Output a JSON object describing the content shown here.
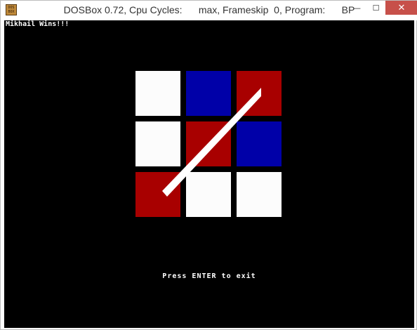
{
  "window": {
    "app_icon_label": "DOS BOX",
    "title": "DOSBox 0.72, Cpu Cycles:      max, Frameskip  0, Program:      BP",
    "controls": {
      "minimize": "—",
      "maximize": "☐",
      "close": "✕"
    }
  },
  "game": {
    "status_text": "Mikhail Wins!!!",
    "footer_text": "Press ENTER to exit",
    "board": [
      [
        "white",
        "blue",
        "red"
      ],
      [
        "white",
        "red",
        "blue"
      ],
      [
        "red",
        "white",
        "white"
      ]
    ],
    "winning_line": "anti-diagonal",
    "colors": {
      "white": "#fcfcfc",
      "blue": "#0000a8",
      "red": "#a80000",
      "line": "#ffffff",
      "background": "#000000"
    }
  }
}
